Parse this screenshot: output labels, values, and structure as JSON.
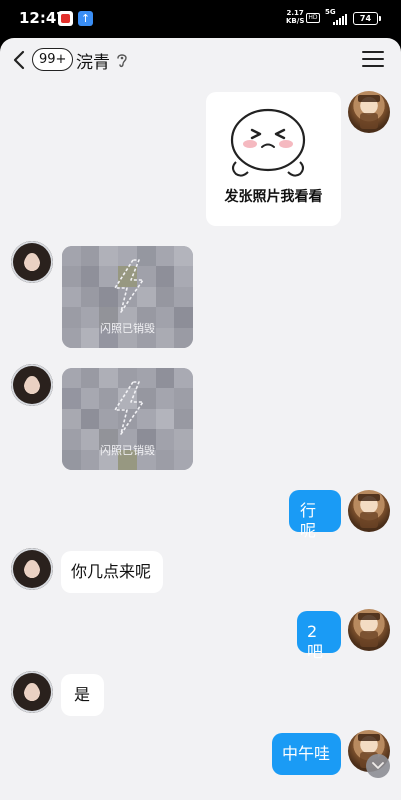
{
  "status_bar": {
    "time": "12:47",
    "speed_value": "2.17",
    "speed_unit": "KB/S",
    "hd": "HD",
    "network": "5G",
    "battery": "74"
  },
  "header": {
    "unread_badge": "99+",
    "contact_name": "浣青"
  },
  "messages": [
    {
      "side": "right",
      "type": "sticker",
      "text": "发张照片我看看"
    },
    {
      "side": "left",
      "type": "flash_photo",
      "text": "闪照已销毁"
    },
    {
      "side": "left",
      "type": "flash_photo",
      "text": "闪照已销毁"
    },
    {
      "side": "right",
      "type": "text",
      "text": "行呢"
    },
    {
      "side": "left",
      "type": "text",
      "text": "你几点来呢"
    },
    {
      "side": "right",
      "type": "text",
      "text": "2吧"
    },
    {
      "side": "left",
      "type": "text",
      "text": "是"
    },
    {
      "side": "right",
      "type": "text",
      "text": "中午哇"
    }
  ],
  "colors": {
    "outgoing_bubble": "#1a9bf5",
    "incoming_bubble": "#ffffff",
    "chat_background": "#f2f2f4"
  }
}
